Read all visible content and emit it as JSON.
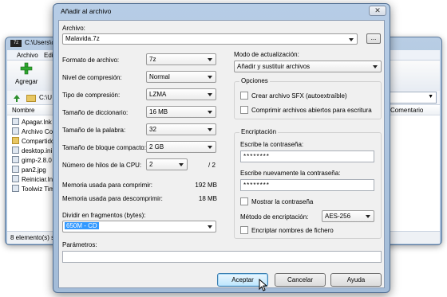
{
  "background_window": {
    "title": "C:\\Users\\cro",
    "app_icon": "7z",
    "menu": [
      "Archivo",
      "Edit"
    ],
    "toolbar": {
      "add_label": "Agregar",
      "add_icon": "green-plus-icon"
    },
    "address": {
      "path": "C:\\U"
    },
    "columns": {
      "name": "Nombre",
      "comment": "Comentario"
    },
    "files": [
      {
        "name": "Apagar.lnk",
        "type": "file"
      },
      {
        "name": "Archivo Co",
        "type": "file"
      },
      {
        "name": "Compartido",
        "type": "folder"
      },
      {
        "name": "desktop.ini",
        "type": "file"
      },
      {
        "name": "gimp-2.8.0",
        "type": "file"
      },
      {
        "name": "pan2.jpg",
        "type": "file"
      },
      {
        "name": "Reiniciar.lnl",
        "type": "file"
      },
      {
        "name": "Toolwiz Tim",
        "type": "file"
      }
    ],
    "status": "8 elemento(s) se"
  },
  "dialog": {
    "title": "Añadir al archivo",
    "close_label": "✕",
    "archive": {
      "label": "Archivo:",
      "value": "Malavida.7z",
      "browse_label": "..."
    },
    "format": {
      "label": "Formato de archivo:",
      "value": "7z"
    },
    "level": {
      "label": "Nivel de compresión:",
      "value": "Normal"
    },
    "method": {
      "label": "Tipo de compresión:",
      "value": "LZMA"
    },
    "dictionary": {
      "label": "Tamaño de diccionario:",
      "value": "16 MB"
    },
    "word_size": {
      "label": "Tamaño de la palabra:",
      "value": "32"
    },
    "solid_block": {
      "label": "Tamaño de bloque compacto:",
      "value": "2 GB"
    },
    "threads": {
      "label": "Número de hilos de la CPU:",
      "value": "2",
      "total": "/ 2"
    },
    "memory_compress": {
      "label": "Memoria usada para comprimir:",
      "value": "192 MB"
    },
    "memory_decompress": {
      "label": "Memoria usada para descomprimir:",
      "value": "18 MB"
    },
    "split": {
      "label": "Dividir en fragmentos (bytes):",
      "value": "650M - CD"
    },
    "parameters": {
      "label": "Parámetros:",
      "value": ""
    },
    "update_mode": {
      "label": "Modo de actualización:",
      "value": "Añadir y sustituir archivos"
    },
    "options": {
      "title": "Opciones",
      "sfx": {
        "label": "Crear archivo SFX (autoextraíble)",
        "checked": false
      },
      "shared": {
        "label": "Comprimir archivos abiertos para escritura",
        "checked": false
      }
    },
    "encryption": {
      "title": "Encriptación",
      "password_label": "Escribe la contraseña:",
      "password_value": "********",
      "reenter_label": "Escribe nuevamente la contraseña:",
      "reenter_value": "********",
      "show_password": {
        "label": "Mostrar la contraseña",
        "checked": false
      },
      "method_label": "Método de encriptación:",
      "method_value": "AES-256",
      "encrypt_names": {
        "label": "Encriptar nombres de fichero",
        "checked": false
      }
    },
    "buttons": {
      "ok": "Aceptar",
      "cancel": "Cancelar",
      "help": "Ayuda"
    }
  }
}
